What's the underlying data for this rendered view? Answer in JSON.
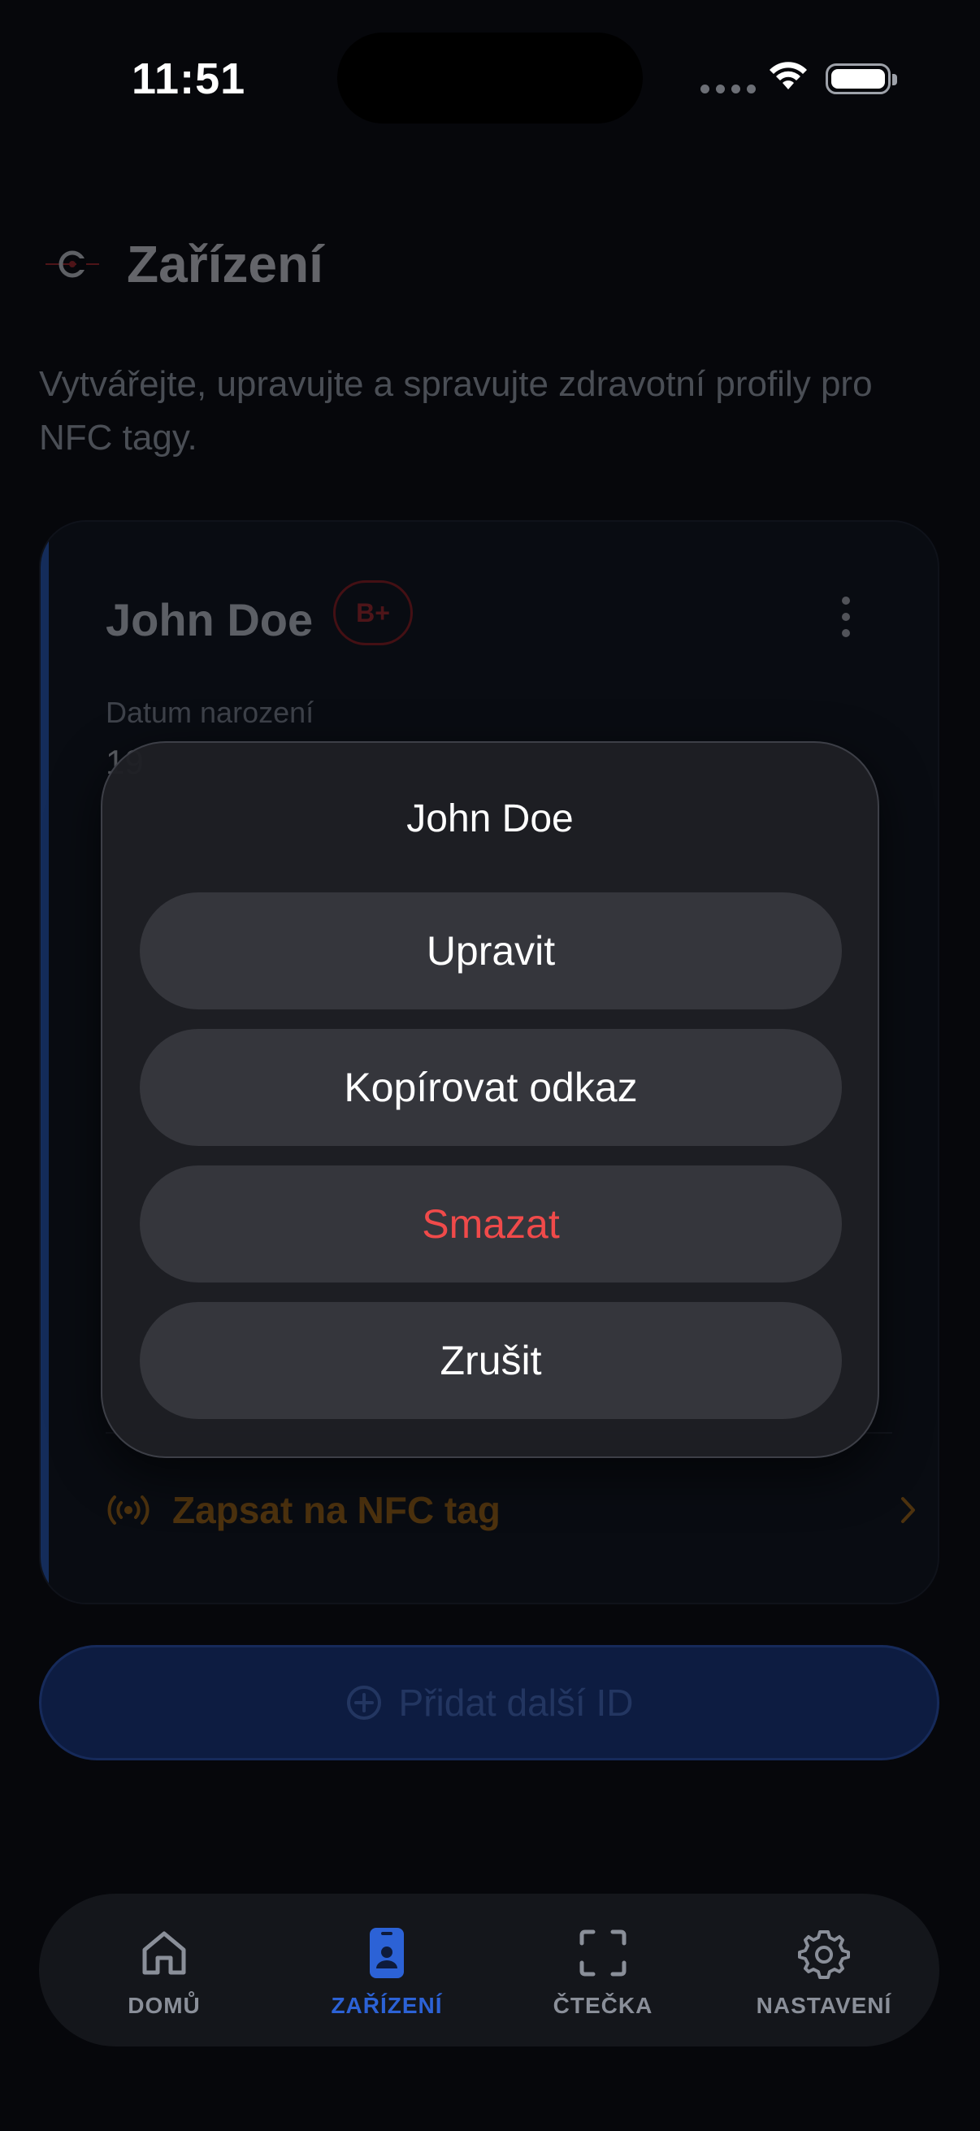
{
  "status_bar": {
    "time": "11:51"
  },
  "header": {
    "title": "Zařízení",
    "description": "Vytvářejte, upravujte a spravujte zdravotní profily pro NFC tagy."
  },
  "card": {
    "name": "John Doe",
    "blood_type": "B+",
    "dob_label": "Datum narození",
    "dob_value_visible": "19",
    "nfc_action_label": "Zapsat na NFC tag",
    "accent_color": "#2a5fc9"
  },
  "add_button": {
    "label": "Přidat další ID"
  },
  "tabbar": {
    "tabs": [
      {
        "label": "DOMŮ",
        "icon": "home-icon",
        "active": false
      },
      {
        "label": "ZAŘÍZENÍ",
        "icon": "phone-badge-icon",
        "active": true
      },
      {
        "label": "ČTEČKA",
        "icon": "scan-frame-icon",
        "active": false
      },
      {
        "label": "NASTAVENÍ",
        "icon": "gear-icon",
        "active": false
      }
    ],
    "active_color": "#2c62d6"
  },
  "action_sheet": {
    "title": "John Doe",
    "edit_label": "Upravit",
    "copy_link_label": "Kopírovat odkaz",
    "delete_label": "Smazat",
    "cancel_label": "Zrušit",
    "destructive_color": "#f04a4a"
  }
}
